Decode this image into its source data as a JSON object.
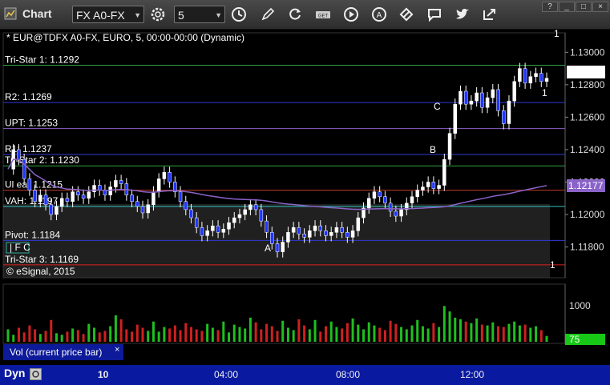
{
  "window": {
    "title": "Chart",
    "symbol": "FX A0-FX",
    "interval": "5"
  },
  "chart": {
    "header": "* EUR@TDFX A0-FX, EURO, 5, 00:00-00:00 (Dynamic)",
    "watermark": "© eSignal, 2015",
    "levels": [
      {
        "label": "Tri-Star 1: 1.1292",
        "price": 1.1292,
        "color": "#2ea043"
      },
      {
        "label": "R2: 1.1269",
        "price": 1.1269,
        "color": "#2f3ad6"
      },
      {
        "label": "UPT: 1.1253",
        "price": 1.1253,
        "color": "#8a63c8"
      },
      {
        "label": "R1: 1.1237",
        "price": 1.1237,
        "color": "#2f3ad6"
      },
      {
        "label": "Tri-Star 2: 1.1230",
        "price": 1.123,
        "color": "#2ea043"
      },
      {
        "label": "Ul  ear  1.1215",
        "price": 1.1215,
        "color": "#c0392b"
      },
      {
        "label": "VAH: 1.1197",
        "price": 1.1205,
        "color": "#2ec4c4"
      },
      {
        "label": "Pivot: 1.1184",
        "price": 1.1184,
        "color": "#2f3ad6"
      },
      {
        "label": "Tri-Star 3: 1.1169",
        "price": 1.1169,
        "color": "#e02020"
      }
    ],
    "price_labels": [
      "1.13000",
      "1.12800",
      "1.12600",
      "1.12400",
      "1.12200",
      "1.12000",
      "1.11800"
    ],
    "current_price": "1.12847",
    "vwap_price": "1.12177",
    "markers": {
      "a": "A",
      "b": "B",
      "c": "C"
    },
    "right_counts": {
      "top": "1",
      "mid": "1",
      "bottom": "1"
    }
  },
  "volume": {
    "label": "Vol (current price bar)",
    "close": "×",
    "axis_label": "1000",
    "current": "75"
  },
  "bottom": {
    "dyn": "Dyn",
    "times": [
      "10",
      "04:00",
      "08:00",
      "12:00"
    ]
  },
  "chart_data": {
    "type": "candlestick",
    "ylim": [
      1.1163,
      1.1312
    ],
    "prices": [
      1.1228,
      1.124,
      1.1234,
      1.1222,
      1.1215,
      1.1208,
      1.1212,
      1.1206,
      1.12,
      1.1205,
      1.121,
      1.1208,
      1.1214,
      1.1212,
      1.121,
      1.1214,
      1.1218,
      1.1215,
      1.1212,
      1.1217,
      1.1221,
      1.1219,
      1.1212,
      1.1208,
      1.1205,
      1.1201,
      1.1206,
      1.1214,
      1.1222,
      1.1226,
      1.122,
      1.1214,
      1.1208,
      1.1203,
      1.1198,
      1.1192,
      1.1187,
      1.119,
      1.1193,
      1.1189,
      1.1191,
      1.1195,
      1.1198,
      1.12,
      1.1203,
      1.1206,
      1.1203,
      1.1196,
      1.1189,
      1.1182,
      1.1177,
      1.1183,
      1.1189,
      1.1192,
      1.1188,
      1.1186,
      1.119,
      1.1193,
      1.119,
      1.1187,
      1.1189,
      1.1192,
      1.1189,
      1.1186,
      1.119,
      1.1198,
      1.1204,
      1.121,
      1.1214,
      1.1211,
      1.1207,
      1.1202,
      1.1199,
      1.1203,
      1.1207,
      1.1211,
      1.1215,
      1.1217,
      1.122,
      1.1216,
      1.1218,
      1.1234,
      1.125,
      1.1268,
      1.1276,
      1.1268,
      1.127,
      1.1275,
      1.1266,
      1.1272,
      1.1277,
      1.1264,
      1.1256,
      1.127,
      1.1282,
      1.129,
      1.1281,
      1.1285,
      1.1287,
      1.1282,
      1.1284
    ],
    "volumes": [
      160,
      90,
      180,
      120,
      210,
      160,
      100,
      140,
      280,
      110,
      90,
      130,
      170,
      150,
      100,
      230,
      180,
      120,
      140,
      200,
      340,
      290,
      160,
      130,
      220,
      180,
      140,
      260,
      130,
      190,
      170,
      210,
      150,
      240,
      190,
      160,
      140,
      230,
      180,
      150,
      260,
      120,
      220,
      190,
      170,
      310,
      250,
      160,
      230,
      200,
      140,
      270,
      180,
      150,
      290,
      210,
      160,
      280,
      130,
      200,
      260,
      190,
      170,
      240,
      300,
      220,
      160,
      250,
      210,
      180,
      150,
      270,
      230,
      190,
      160,
      210,
      280,
      200,
      170,
      240,
      190,
      460,
      390,
      310,
      290,
      260,
      240,
      300,
      220,
      210,
      250,
      200,
      190,
      230,
      260,
      210,
      220,
      180,
      200,
      150,
      75
    ],
    "vol_ylim": [
      0,
      720
    ]
  }
}
